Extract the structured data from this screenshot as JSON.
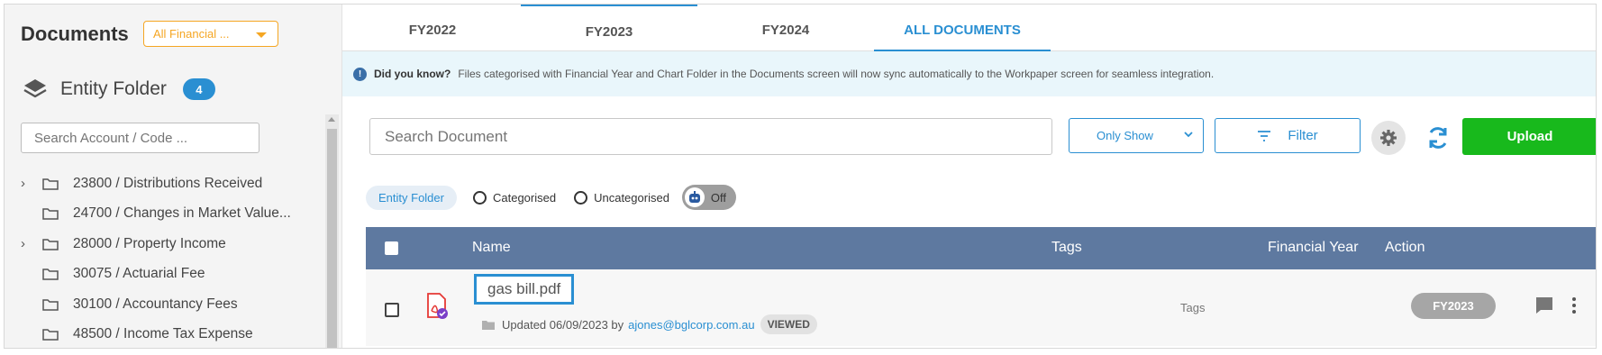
{
  "sidebar": {
    "title": "Documents",
    "year_select": "All Financial ...",
    "entity_folder_label": "Entity Folder",
    "entity_folder_count": "4",
    "search_placeholder": "Search Account / Code ...",
    "tree": [
      {
        "label": "23800 / Distributions Received",
        "expandable": true
      },
      {
        "label": "24700 / Changes in Market Value...",
        "expandable": false
      },
      {
        "label": "28000 / Property Income",
        "expandable": true
      },
      {
        "label": "30075 / Actuarial Fee",
        "expandable": false
      },
      {
        "label": "30100 / Accountancy Fees",
        "expandable": false
      },
      {
        "label": "48500 / Income Tax Expense",
        "expandable": false
      }
    ]
  },
  "tabs": [
    {
      "label": "FY2022"
    },
    {
      "label": "FY2023"
    },
    {
      "label": "FY2024"
    },
    {
      "label": "ALL DOCUMENTS"
    }
  ],
  "info": {
    "lead": "Did you know?",
    "text": "Files categorised with Financial Year and Chart Folder in the Documents screen will now sync automatically to the Workpaper screen for seamless integration."
  },
  "toolbar": {
    "search_placeholder": "Search Document",
    "only_show": "Only Show",
    "filter_label": "Filter",
    "upload_label": "Upload"
  },
  "filters": {
    "chip": "Entity Folder",
    "radio_categorised": "Categorised",
    "radio_uncategorised": "Uncategorised",
    "toggle_state": "Off"
  },
  "table": {
    "headers": {
      "name": "Name",
      "tags": "Tags",
      "fy": "Financial Year",
      "action": "Action"
    },
    "rows": [
      {
        "filename": "gas bill.pdf",
        "updated": "Updated 06/09/2023 by",
        "user": "ajones@bglcorp.com.au",
        "status": "VIEWED",
        "tags": "Tags",
        "fy": "FY2023"
      }
    ]
  },
  "colors": {
    "accent": "#2a8fd2",
    "upload_green": "#18b91c",
    "header_bg": "#5e79a0",
    "select_orange": "#f5a623"
  }
}
